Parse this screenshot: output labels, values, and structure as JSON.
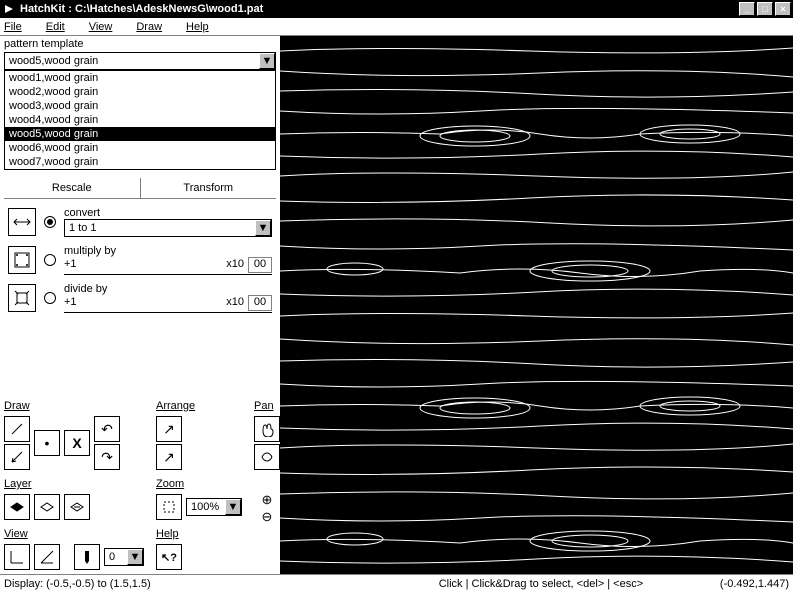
{
  "window": {
    "title": "HatchKit : C:\\Hatches\\AdeskNewsG\\wood1.pat"
  },
  "menu": {
    "file": "File",
    "edit": "Edit",
    "view": "View",
    "draw": "Draw",
    "help": "Help"
  },
  "template": {
    "label": "pattern template",
    "selected": "wood5,wood grain",
    "options": [
      "wood1,wood grain",
      "wood2,wood grain",
      "wood3,wood grain",
      "wood4,wood grain",
      "wood5,wood grain",
      "wood6,wood grain",
      "wood7,wood grain"
    ]
  },
  "tabs": {
    "rescale": "Rescale",
    "transform": "Transform"
  },
  "convert": {
    "label": "convert",
    "value": "1 to 1"
  },
  "multiply": {
    "label": "multiply by",
    "value": "+1",
    "x10label": "x10",
    "x10value": "00"
  },
  "divide": {
    "label": "divide by",
    "value": "+1",
    "x10label": "x10",
    "x10value": "00"
  },
  "tools": {
    "draw": "Draw",
    "arrange": "Arrange",
    "pan": "Pan",
    "layer": "Layer",
    "zoom": "Zoom",
    "zoom_value": "100%",
    "view": "View",
    "help": "Help",
    "x_label": "X",
    "zero_value": "0"
  },
  "status": {
    "display": "Display: (-0.5,-0.5) to (1.5,1.5)",
    "hint": "Click | Click&Drag to select, <del> | <esc>",
    "coords": "(-0.492,1.447)"
  }
}
